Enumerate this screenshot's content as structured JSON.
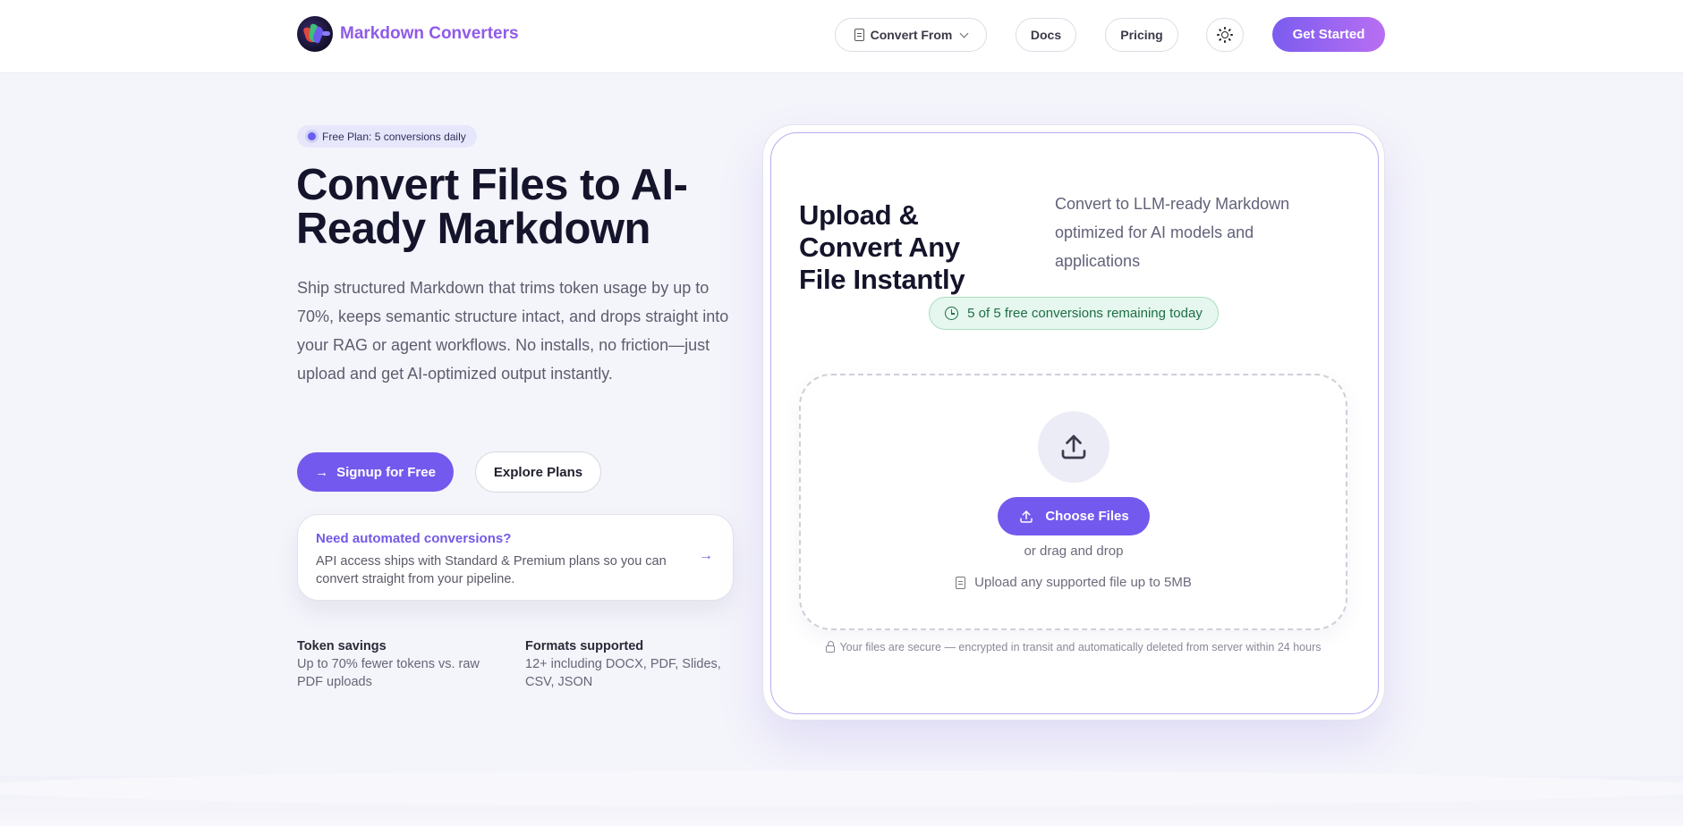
{
  "header": {
    "brand": "Markdown Converters",
    "nav": {
      "convert_from": "Convert From",
      "docs": "Docs",
      "pricing": "Pricing",
      "get_started": "Get Started"
    }
  },
  "hero": {
    "badge": "Free Plan: 5 conversions daily",
    "title": "Convert Files to AI-Ready Markdown",
    "description": "Ship structured Markdown that trims token usage by up to 70%, keeps semantic structure intact, and drops straight into your RAG or agent workflows. No installs, no friction—just upload and get AI-optimized output instantly.",
    "signup_label": "Signup for Free",
    "plans_label": "Explore Plans",
    "api_card": {
      "title": "Need automated conversions?",
      "text": "API access ships with Standard & Premium plans so you can convert straight from your pipeline."
    },
    "stats": [
      {
        "title": "Token savings",
        "text": "Up to 70% fewer tokens vs. raw PDF uploads"
      },
      {
        "title": "Formats supported",
        "text": "12+ including DOCX, PDF, Slides, CSV, JSON"
      }
    ]
  },
  "upload": {
    "title": "Upload & Convert Any File Instantly",
    "description": "Convert to LLM-ready Markdown optimized for AI models and applications",
    "remaining": "5 of 5 free conversions remaining today",
    "choose_label": "Choose Files",
    "drag_text": "or drag and drop",
    "size_text": "Upload any supported file up to 5MB",
    "secure_text": "Your files are secure — encrypted in transit and automatically deleted from server within 24 hours"
  },
  "colors": {
    "accent": "#7459ee",
    "brand_text": "#8f5be8",
    "success_bg": "#e5f7ee",
    "success_text": "#1f6e47"
  }
}
